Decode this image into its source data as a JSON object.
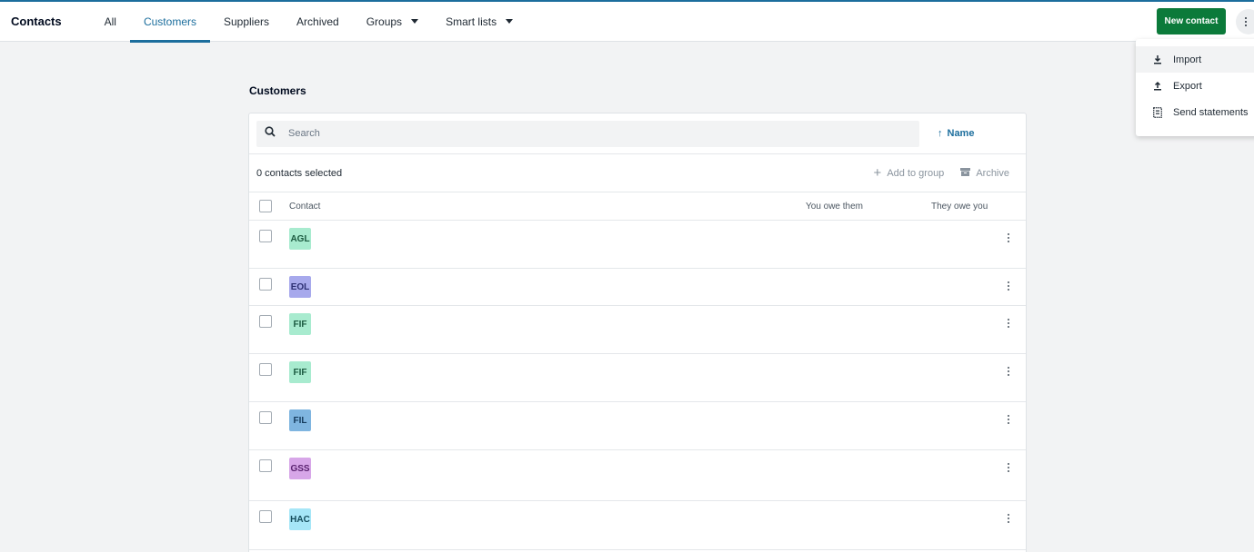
{
  "nav": {
    "title": "Contacts",
    "tabs": [
      {
        "label": "All",
        "active": false,
        "dropdown": false
      },
      {
        "label": "Customers",
        "active": true,
        "dropdown": false
      },
      {
        "label": "Suppliers",
        "active": false,
        "dropdown": false
      },
      {
        "label": "Archived",
        "active": false,
        "dropdown": false
      },
      {
        "label": "Groups",
        "active": false,
        "dropdown": true
      },
      {
        "label": "Smart lists",
        "active": false,
        "dropdown": true
      }
    ],
    "new_contact_label": "New contact",
    "more_icon": "kebab-vertical-icon"
  },
  "menu": {
    "items": [
      {
        "label": "Import",
        "icon": "download-icon"
      },
      {
        "label": "Export",
        "icon": "upload-icon"
      },
      {
        "label": "Send statements",
        "icon": "statement-icon"
      }
    ]
  },
  "page": {
    "section_title": "Customers",
    "search_placeholder": "Search",
    "search_value": "",
    "sort_label": "Name",
    "sort_direction": "ascending",
    "selected_text": "0 contacts selected",
    "add_to_group_label": "Add to group",
    "archive_label": "Archive",
    "columns": {
      "contact": "Contact",
      "you_owe_them": "You owe them",
      "they_owe_you": "They owe you"
    }
  },
  "rows": [
    {
      "initials": "AGL",
      "bg": "#a8ebcf",
      "fg": "#1b5a40"
    },
    {
      "initials": "EOL",
      "bg": "#a7a9ec",
      "fg": "#2c2f72"
    },
    {
      "initials": "FIF",
      "bg": "#a8ebcf",
      "fg": "#1b5a40"
    },
    {
      "initials": "FIF",
      "bg": "#a8ebcf",
      "fg": "#1b5a40"
    },
    {
      "initials": "FIL",
      "bg": "#7fb5e0",
      "fg": "#143a5c"
    },
    {
      "initials": "GSS",
      "bg": "#d7a6e8",
      "fg": "#5a2270"
    },
    {
      "initials": "HAC",
      "bg": "#a6e6f7",
      "fg": "#154d5c"
    }
  ],
  "colors": {
    "accent": "#1c6e9d",
    "primary_button": "#0b7a3a"
  }
}
